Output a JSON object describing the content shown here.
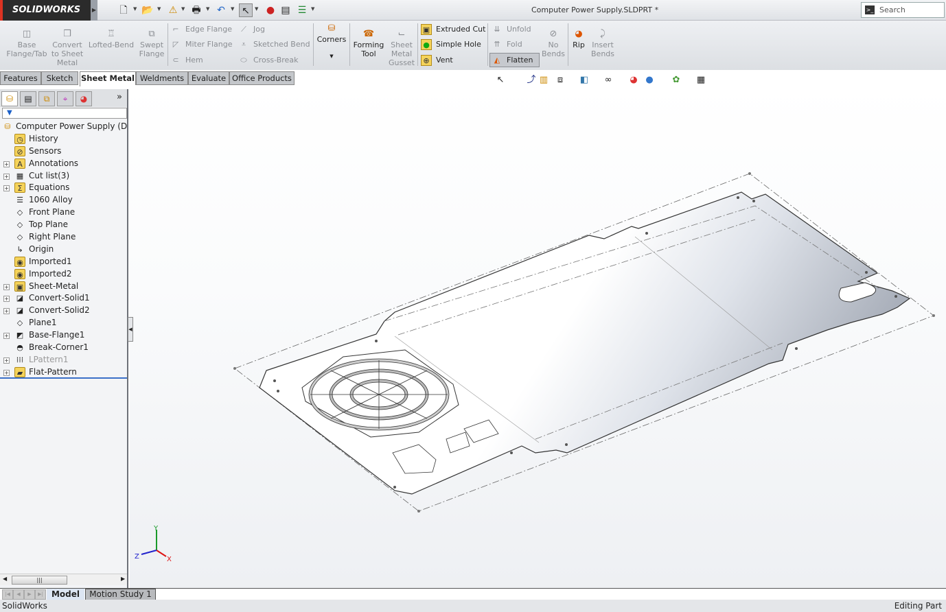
{
  "app": {
    "brand": "SOLIDWORKS",
    "document_title": "Computer Power Supply.SLDPRT *",
    "search_placeholder": "Search Commands"
  },
  "quick_access": [
    "new-icon",
    "open-icon",
    "rebuild-icon",
    "print-icon",
    "undo-icon",
    "select-icon",
    "traffic-light-icon",
    "file-properties-icon",
    "options-icon"
  ],
  "ribbon": {
    "base_flange": "Base Flange/Tab",
    "convert": "Convert to Sheet Metal",
    "lofted_bend": "Lofted-Bend",
    "swept_flange": "Swept Flange",
    "edge_flange": "Edge Flange",
    "miter_flange": "Miter Flange",
    "hem": "Hem",
    "jog": "Jog",
    "sketched_bend": "Sketched Bend",
    "cross_break": "Cross-Break",
    "corners": "Corners",
    "forming_tool": "Forming Tool",
    "gusset": "Sheet Metal Gusset",
    "extruded_cut": "Extruded Cut",
    "simple_hole": "Simple Hole",
    "vent": "Vent",
    "unfold": "Unfold",
    "fold": "Fold",
    "flatten": "Flatten",
    "no_bends": "No Bends",
    "rip": "Rip",
    "insert_bends": "Insert Bends"
  },
  "tabs": [
    {
      "label": "Features"
    },
    {
      "label": "Sketch"
    },
    {
      "label": "Sheet Metal",
      "active": true
    },
    {
      "label": "Weldments"
    },
    {
      "label": "Evaluate"
    },
    {
      "label": "Office Products"
    }
  ],
  "tree": {
    "root": "Computer Power Supply  (Defa",
    "items": [
      {
        "label": "History"
      },
      {
        "label": "Sensors"
      },
      {
        "label": "Annotations"
      },
      {
        "label": "Cut list(3)"
      },
      {
        "label": "Equations"
      },
      {
        "label": "1060 Alloy"
      },
      {
        "label": "Front Plane"
      },
      {
        "label": "Top Plane"
      },
      {
        "label": "Right Plane"
      },
      {
        "label": "Origin"
      },
      {
        "label": "Imported1"
      },
      {
        "label": "Imported2"
      },
      {
        "label": "Sheet-Metal"
      },
      {
        "label": "Convert-Solid1"
      },
      {
        "label": "Convert-Solid2"
      },
      {
        "label": "Plane1"
      },
      {
        "label": "Base-Flange1"
      },
      {
        "label": "Break-Corner1"
      },
      {
        "label": "LPattern1",
        "suppressed": true
      },
      {
        "label": "Flat-Pattern"
      }
    ]
  },
  "triad": {
    "x": "X",
    "y": "Y",
    "z": "Z"
  },
  "bottom_tabs": {
    "model": "Model",
    "motion": "Motion Study 1"
  },
  "status": {
    "left": "SolidWorks",
    "right": "Editing Part"
  },
  "colors": {
    "accent": "#3a6fc7",
    "logo_bg": "#2b2b2b",
    "ribbon": "#e3e5e8"
  }
}
